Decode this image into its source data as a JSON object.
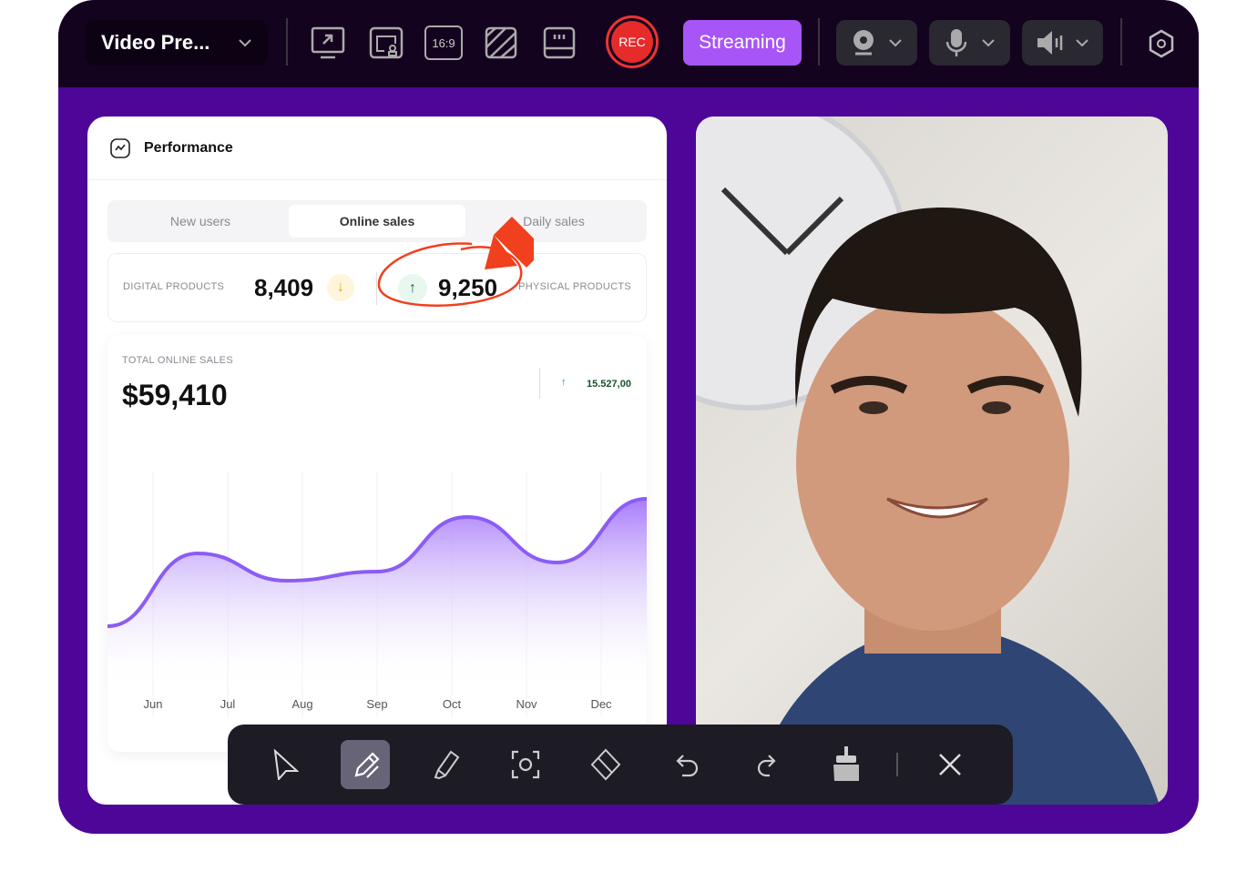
{
  "topbar": {
    "source_select": "Video Pre...",
    "rec_label": "REC",
    "streaming_label": "Streaming",
    "tools": [
      "share-screen-icon",
      "picture-in-picture-icon",
      "aspect-ratio-icon",
      "background-pattern-icon",
      "layout-icon"
    ],
    "aspect_ratio": "16:9",
    "devices": [
      "webcam-icon",
      "microphone-icon",
      "speaker-icon"
    ],
    "settings": "settings-icon"
  },
  "card": {
    "title": "Performance",
    "tabs": [
      {
        "label": "New users",
        "active": false
      },
      {
        "label": "Online sales",
        "active": true
      },
      {
        "label": "Daily sales",
        "active": false
      }
    ],
    "stats": {
      "digital_label": "DIGITAL PRODUCTS",
      "digital_value": "8,409",
      "physical_label": "PHYSICAL PRODUCTS",
      "physical_value": "9,250"
    },
    "total_label": "TOTAL ONLINE SALES",
    "total_value": "$59,410",
    "change": "15.527,00"
  },
  "chart_data": {
    "type": "area",
    "categories": [
      "Jun",
      "Jul",
      "Aug",
      "Sep",
      "Oct",
      "Nov",
      "Dec"
    ],
    "values": [
      20,
      60,
      45,
      50,
      80,
      55,
      90
    ],
    "color": "#8b5cf6"
  },
  "draw_toolbar": {
    "tools": [
      "pointer-icon",
      "pencil-icon",
      "highlighter-icon",
      "screenshot-icon",
      "eraser-icon",
      "undo-icon",
      "redo-icon",
      "clear-brush-icon"
    ],
    "active": "pencil-icon",
    "close": "close-icon"
  },
  "colors": {
    "frame": "#4e0699",
    "topbar": "#14031f",
    "accent": "#a855f7",
    "rec": "#e72b2b",
    "annotation": "#f0401e"
  }
}
